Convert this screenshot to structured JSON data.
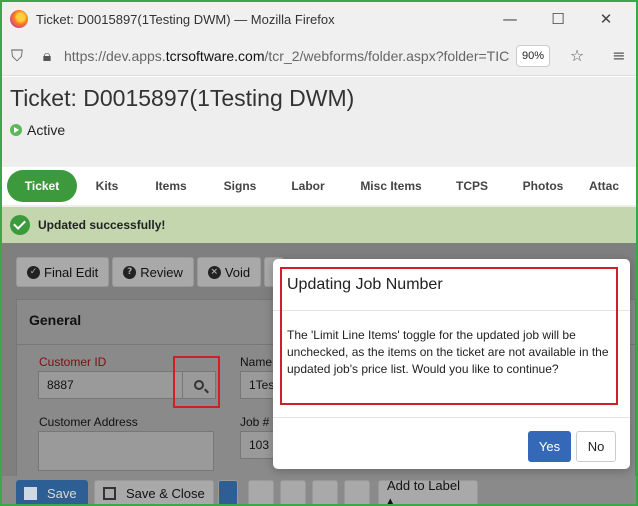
{
  "window": {
    "title": "Ticket: D0015897(1Testing DWM) — Mozilla Firefox",
    "minimize": "—",
    "maximize": "☐",
    "close": "✕"
  },
  "browser": {
    "url_prefix": "https://dev.apps.",
    "url_domain": "tcrsoftware.com",
    "url_suffix": "/tcr_2/webforms/folder.aspx?folder=TIC",
    "zoom": "90%"
  },
  "page": {
    "title": "Ticket: D0015897(1Testing DWM)",
    "status": "Active"
  },
  "tabs": [
    {
      "label": "Ticket"
    },
    {
      "label": "Kits"
    },
    {
      "label": "Items"
    },
    {
      "label": "Signs"
    },
    {
      "label": "Labor"
    },
    {
      "label": "Misc Items"
    },
    {
      "label": "TCPS"
    },
    {
      "label": "Photos"
    },
    {
      "label": "Attac"
    }
  ],
  "alert": {
    "message": "Updated successfully!"
  },
  "toolbar": {
    "final_edit": "Final Edit",
    "review": "Review",
    "void": "Void"
  },
  "general": {
    "title": "General",
    "customer_id_label": "Customer ID",
    "customer_id_value": "8887",
    "name_label": "Name",
    "name_value": "1Tes",
    "customer_address_label": "Customer Address",
    "job_label": "Job #",
    "job_value": "103"
  },
  "bottom": {
    "save": "Save",
    "save_close": "Save & Close",
    "add_to_label": "Add to Label ▴"
  },
  "modal": {
    "title": "Updating Job Number",
    "body": "The 'Limit Line Items' toggle for the updated job will be unchecked, as the items on the ticket are not available in the updated job's price list. Would you like to continue?",
    "yes": "Yes",
    "no": "No"
  },
  "colors": {
    "active_tab": "#3c9a3c",
    "success_bar": "#c3d6ae",
    "primary_button": "#3569b8",
    "highlight_box": "#d11f2a",
    "frame_border": "#3aa84a"
  }
}
